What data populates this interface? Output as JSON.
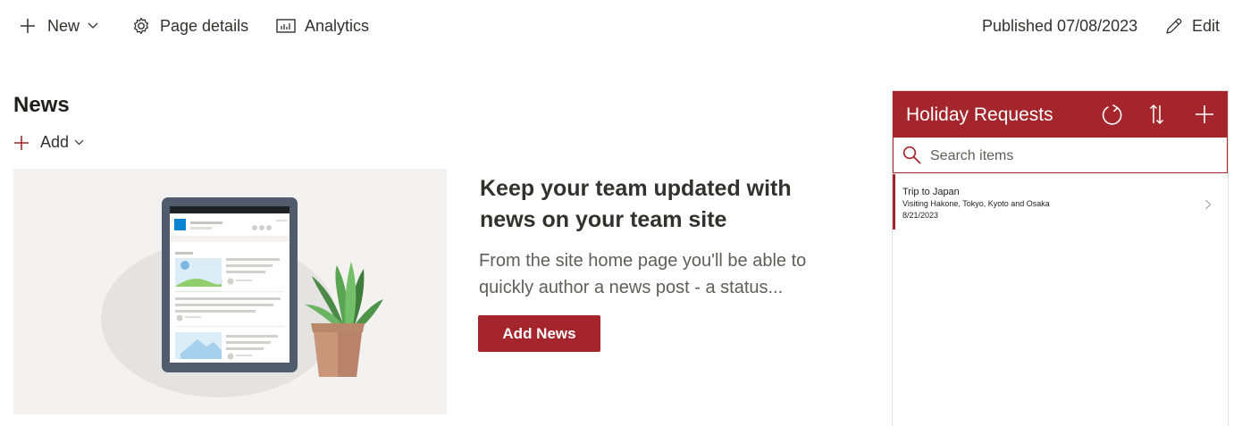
{
  "toolbar": {
    "new_label": "New",
    "page_details_label": "Page details",
    "analytics_label": "Analytics",
    "published_text": "Published 07/08/2023",
    "edit_label": "Edit"
  },
  "news": {
    "title": "News",
    "add_label": "Add",
    "headline": "Keep your team updated with news on your team site",
    "description": "From the site home page you'll be able to quickly author a news post - a status...",
    "add_news_button": "Add News"
  },
  "holiday": {
    "title": "Holiday Requests",
    "search_placeholder": "Search items",
    "items": [
      {
        "title": "Trip to Japan",
        "subtitle": "Visiting Hakone, Tokyo, Kyoto and Osaka",
        "date": "8/21/2023"
      }
    ]
  },
  "colors": {
    "accent": "#a4262c",
    "text": "#323130",
    "muted": "#605e5c",
    "hero_bg": "#f3f2f1"
  },
  "icons": [
    "plus-icon",
    "chevron-down-icon",
    "gear-icon",
    "analytics-icon",
    "pencil-icon",
    "refresh-icon",
    "sort-icon",
    "search-icon",
    "chevron-right-icon"
  ]
}
